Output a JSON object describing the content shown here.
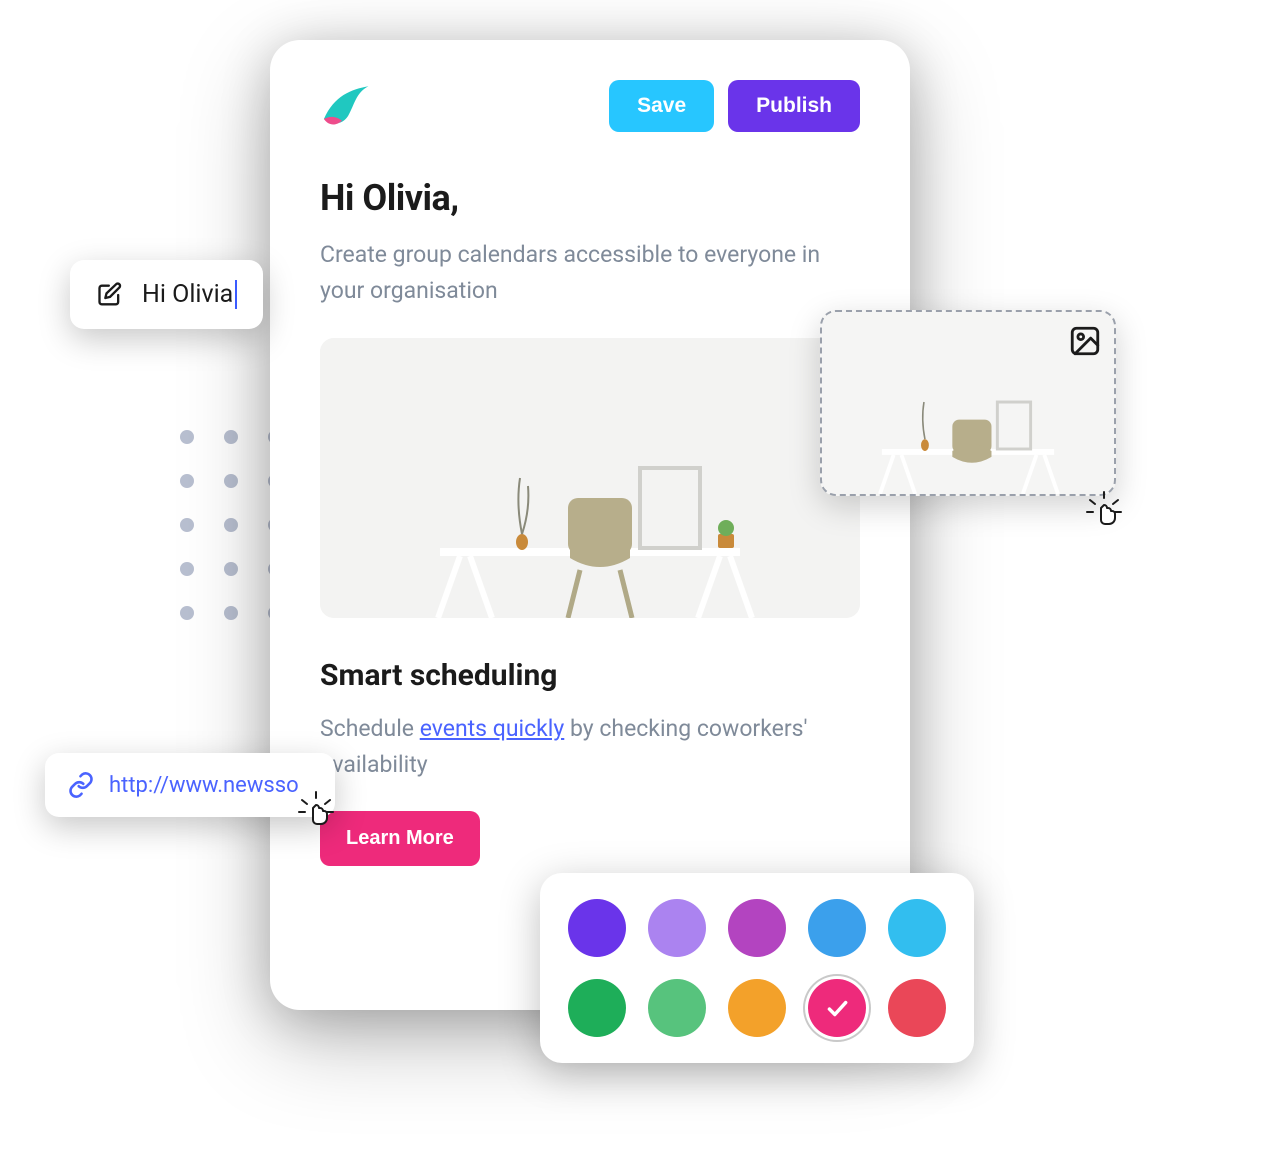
{
  "header": {
    "save_label": "Save",
    "publish_label": "Publish"
  },
  "email": {
    "greeting": "Hi Olivia,",
    "intro": "Create group calendars accessible to everyone in your organisation",
    "section_title": "Smart scheduling",
    "section_body_pre": "Schedule ",
    "section_body_link": "events quickly",
    "section_body_post": " by checking coworkers' availability",
    "cta_label": "Learn More"
  },
  "edit_popup": {
    "value": "Hi Olivia"
  },
  "link_popup": {
    "url": "http://www.newsso"
  },
  "palette": {
    "colors": [
      "#6a34ea",
      "#ab83f0",
      "#b344c0",
      "#3ba0ec",
      "#32beef",
      "#1eae59",
      "#57c37d",
      "#f3a12a",
      "#ee2a7b",
      "#ea4758"
    ],
    "selected_index": 8
  },
  "icons": {
    "edit": "edit-icon",
    "link": "link-icon",
    "image": "image-icon",
    "check": "check-icon",
    "click": "click-cursor-icon",
    "logo": "bird-logo-icon"
  }
}
